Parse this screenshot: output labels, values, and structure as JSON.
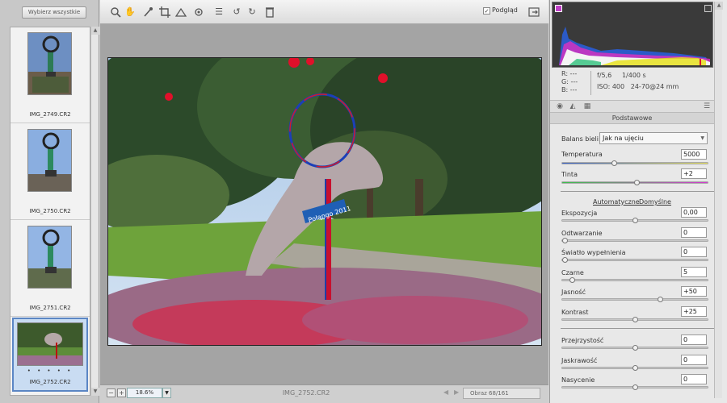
{
  "filmstrip": {
    "select_all_label": "Wybierz wszystkie",
    "items": [
      {
        "name": "IMG_2749.CR2",
        "selected": false
      },
      {
        "name": "IMG_2750.CR2",
        "selected": false
      },
      {
        "name": "IMG_2751.CR2",
        "selected": false
      },
      {
        "name": "IMG_2752.CR2",
        "selected": true,
        "rating_dots": "• • • • •"
      }
    ]
  },
  "toolbar": {
    "tools": [
      "zoom-tool-icon",
      "hand-tool-icon",
      "white-balance-icon",
      "crop-icon",
      "straighten-icon",
      "redeye-icon",
      "preferences-icon",
      "rotate-left-icon",
      "rotate-right-icon",
      "trash-icon"
    ],
    "preview_label": "Podgląd",
    "preview_checked": true
  },
  "status": {
    "zoom_minus": "−",
    "zoom_plus": "+",
    "zoom_value": "18.6%",
    "filename": "IMG_2752.CR2",
    "image_count": "Obraz 68/161"
  },
  "readout": {
    "r": "R:  ---",
    "g": "G:  ---",
    "b": "B:  ---",
    "aperture": "f/5,6",
    "shutter": "1/400 s",
    "iso": "ISO: 400",
    "lens": "24-70@24 mm"
  },
  "panel": {
    "title": "Podstawowe",
    "wb_label": "Balans bieli:",
    "wb_value": "Jak na ujęciu",
    "temperature_label": "Temperatura",
    "temperature_value": "5000",
    "temperature_pos": 0.35,
    "tint_label": "Tinta",
    "tint_value": "+2",
    "tint_pos": 0.51,
    "auto_label": "Automatyczne",
    "default_label": "Domyślne",
    "sliders1": [
      {
        "label": "Ekspozycja",
        "value": "0,00",
        "pos": 0.5
      },
      {
        "label": "Odtwarzanie",
        "value": "0",
        "pos": 0.0
      },
      {
        "label": "Światło wypełnienia",
        "value": "0",
        "pos": 0.0
      },
      {
        "label": "Czarne",
        "value": "5",
        "pos": 0.05
      },
      {
        "label": "Jasność",
        "value": "+50",
        "pos": 0.68
      },
      {
        "label": "Kontrast",
        "value": "+25",
        "pos": 0.5
      }
    ],
    "sliders2": [
      {
        "label": "Przejrzystość",
        "value": "0",
        "pos": 0.5
      },
      {
        "label": "Jaskrawość",
        "value": "0",
        "pos": 0.5
      },
      {
        "label": "Nasycenie",
        "value": "0",
        "pos": 0.5
      }
    ]
  },
  "photo": {
    "sign_text": "Połąngo 2011"
  }
}
